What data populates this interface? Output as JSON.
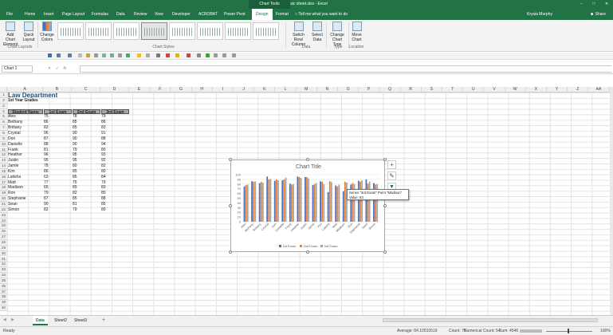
{
  "window": {
    "title": "Basic sheet.xlsx - Excel",
    "context_tab_group": "Chart Tools",
    "controls": [
      "–",
      "□",
      "✕"
    ]
  },
  "ribbon_tabs": [
    {
      "label": "File",
      "active": false
    },
    {
      "label": "Home",
      "active": false
    },
    {
      "label": "Insert",
      "active": false
    },
    {
      "label": "Page Layout",
      "active": false
    },
    {
      "label": "Formulas",
      "active": false
    },
    {
      "label": "Data",
      "active": false
    },
    {
      "label": "Review",
      "active": false
    },
    {
      "label": "View",
      "active": false
    },
    {
      "label": "Developer",
      "active": false
    },
    {
      "label": "ACROBAT",
      "active": false
    },
    {
      "label": "Power Pivot",
      "active": false
    },
    {
      "label": "Design",
      "active": true
    },
    {
      "label": "Format",
      "active": false
    }
  ],
  "tell_me": "Tell me what you want to do",
  "user_name": "Krysia Murphy",
  "share_label": "Share",
  "ribbon": {
    "add_chart_element": "Add Chart Element",
    "quick_layout": "Quick Layout",
    "change_colors": "Change Colors",
    "switch_row_column": "Switch Row/ Column",
    "select_data": "Select Data",
    "change_chart_type": "Change Chart Type",
    "move_chart": "Move Chart",
    "groups": {
      "chart_layouts": "Chart Layouts",
      "chart_styles": "Chart Styles",
      "data": "Data",
      "type": "Type",
      "location": "Location"
    }
  },
  "formula_bar": {
    "name_box": "Chart 1",
    "cancel": "✕",
    "enter": "✓",
    "fx": "fx",
    "content": ""
  },
  "columns": [
    "A",
    "B",
    "C",
    "D",
    "E",
    "F",
    "G",
    "H",
    "I",
    "J",
    "K",
    "L",
    "M",
    "N",
    "O",
    "P",
    "Q",
    "R",
    "S",
    "T",
    "U",
    "V",
    "W",
    "X",
    "Y",
    "Z",
    "AA"
  ],
  "row_count": 40,
  "sheet": {
    "title": "Law Department",
    "subtitle": "1st Year Grades",
    "headers": [
      "Student Name",
      "1st Exam",
      "2nd Exam",
      "3rd Exam"
    ],
    "rows": [
      [
        "Alex",
        "75",
        "78",
        "79"
      ],
      [
        "Bethany",
        "86",
        "85",
        "86"
      ],
      [
        "Brittany",
        "82",
        "85",
        "83"
      ],
      [
        "Crystal",
        "96",
        "90",
        "91"
      ],
      [
        "Don",
        "87",
        "90",
        "88"
      ],
      [
        "Danielle",
        "88",
        "90",
        "94"
      ],
      [
        "Frank",
        "81",
        "79",
        "80"
      ],
      [
        "Heather",
        "96",
        "95",
        "93"
      ],
      [
        "Justin",
        "95",
        "95",
        "92"
      ],
      [
        "Jamie",
        "78",
        "80",
        "82"
      ],
      [
        "Kim",
        "86",
        "85",
        "80"
      ],
      [
        "Latisha",
        "63",
        "86",
        "84"
      ],
      [
        "Matt",
        "77",
        "75",
        "79"
      ],
      [
        "Madison",
        "65",
        "85",
        "83"
      ],
      [
        "Ron",
        "79",
        "82",
        "80"
      ],
      [
        "Stephanie",
        "87",
        "85",
        "88"
      ],
      [
        "Sean",
        "90",
        "81",
        "85"
      ],
      [
        "Simon",
        "82",
        "79",
        "80"
      ]
    ]
  },
  "chart_data": {
    "type": "bar",
    "title": "Chart Title",
    "categories": [
      "Alex",
      "Bethany",
      "Brittany",
      "Crystal",
      "Don",
      "Danielle",
      "Frank",
      "Heather",
      "Justin",
      "Jamie",
      "Kim",
      "Latisha",
      "Matt",
      "Madison",
      "Ron",
      "Stephanie",
      "Sean",
      "Simon"
    ],
    "series": [
      {
        "name": "1st Exam",
        "color": "#4472c4",
        "values": [
          75,
          86,
          82,
          96,
          87,
          88,
          81,
          96,
          95,
          78,
          86,
          63,
          77,
          65,
          79,
          87,
          90,
          82
        ]
      },
      {
        "name": "2nd Exam",
        "color": "#ed7d31",
        "values": [
          78,
          85,
          85,
          90,
          90,
          90,
          79,
          95,
          95,
          80,
          85,
          86,
          75,
          85,
          82,
          85,
          81,
          79
        ]
      },
      {
        "name": "3rd Exam",
        "color": "#a5a5a5",
        "values": [
          79,
          86,
          83,
          91,
          88,
          94,
          80,
          93,
          92,
          82,
          80,
          84,
          79,
          83,
          80,
          88,
          85,
          80
        ]
      }
    ],
    "ylim": [
      0,
      100
    ],
    "yticks": [
      "0",
      "10",
      "20",
      "30",
      "40",
      "50",
      "60",
      "70",
      "80",
      "90",
      "100"
    ],
    "grid": true,
    "legend": "bottom"
  },
  "tooltip": {
    "line1": "Series \"3rd Exam\" Point \"Madison\"",
    "line2": "Value: 83"
  },
  "sheet_tabs": [
    {
      "label": "Data",
      "active": true
    },
    {
      "label": "Sheet2",
      "active": false
    },
    {
      "label": "Sheet3",
      "active": false
    }
  ],
  "add_sheet": "+",
  "status": {
    "mode": "Ready",
    "average": "Average: 84.10510519",
    "count": "Count: 76",
    "numerical_count": "Numerical Count: 54",
    "sum": "Sum: 4546",
    "zoom": "100%"
  },
  "colors": {
    "accent": "#217346"
  }
}
